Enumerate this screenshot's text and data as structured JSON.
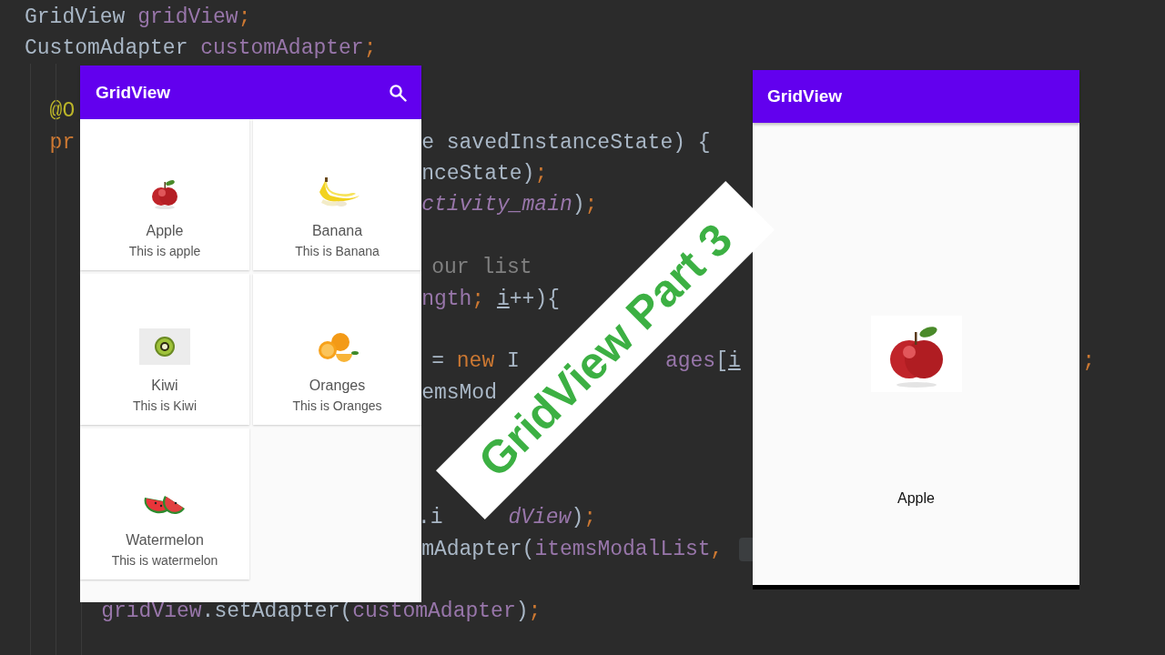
{
  "editor": {
    "lines": [
      {
        "fragments": [
          {
            "parts": [
              {
                "text": "GridView ",
                "kind": "plain"
              },
              {
                "text": "gridView",
                "kind": "field"
              },
              {
                "text": ";",
                "kind": "punct"
              }
            ]
          }
        ]
      },
      {
        "fragments": [
          {
            "parts": [
              {
                "text": "CustomAdapter ",
                "kind": "plain"
              },
              {
                "text": "customAdapter",
                "kind": "field"
              },
              {
                "text": ";",
                "kind": "punct"
              }
            ]
          }
        ]
      },
      {
        "fragments": [
          {
            "parts": [
              {
                "text": "@O",
                "kind": "annotation"
              }
            ]
          }
        ]
      },
      {
        "fragments": [
          {
            "parts": [
              {
                "text": "pr",
                "kind": "keyword"
              }
            ]
          },
          {
            "parts": [
              {
                "text": "e savedInstanceState) {",
                "kind": "plain"
              }
            ]
          }
        ]
      },
      {
        "fragments": [
          {
            "parts": [
              {
                "text": "nceState)",
                "kind": "plain"
              },
              {
                "text": ";",
                "kind": "punct"
              }
            ]
          }
        ]
      },
      {
        "fragments": [
          {
            "parts": [
              {
                "text": "ctivity_main",
                "kind": "italic"
              },
              {
                "text": ")",
                "kind": "plain"
              },
              {
                "text": ";",
                "kind": "punct"
              }
            ]
          }
        ]
      },
      {
        "fragments": [
          {
            "parts": [
              {
                "text": "our list",
                "kind": "comment"
              }
            ]
          }
        ]
      },
      {
        "fragments": [
          {
            "parts": [
              {
                "text": "ngth",
                "kind": "field"
              },
              {
                "text": "; ",
                "kind": "punct"
              },
              {
                "text": "i",
                "kind": "underline"
              },
              {
                "text": "++){",
                "kind": "plain"
              }
            ]
          }
        ]
      },
      {
        "fragments": [
          {
            "parts": [
              {
                "text": "= ",
                "kind": "plain"
              },
              {
                "text": "new ",
                "kind": "keyword"
              },
              {
                "text": "I",
                "kind": "plain"
              }
            ]
          },
          {
            "parts": [
              {
                "text": "ages",
                "kind": "field"
              },
              {
                "text": "[",
                "kind": "plain"
              },
              {
                "text": "i",
                "kind": "underline"
              }
            ]
          },
          {
            "parts": [
              {
                "text": ";",
                "kind": "punct"
              }
            ]
          }
        ]
      },
      {
        "fragments": [
          {
            "parts": [
              {
                "text": "emsMod",
                "kind": "plain"
              }
            ]
          }
        ]
      },
      {
        "fragments": [
          {
            "parts": [
              {
                "text": ".i",
                "kind": "plain"
              }
            ]
          },
          {
            "parts": [
              {
                "text": "dView",
                "kind": "italic"
              },
              {
                "text": ")",
                "kind": "plain"
              },
              {
                "text": ";",
                "kind": "punct"
              }
            ]
          }
        ]
      },
      {
        "fragments": [
          {
            "parts": [
              {
                "text": "mAdapter(",
                "kind": "plain"
              },
              {
                "text": "itemsModalList",
                "kind": "field"
              },
              {
                "text": ", ",
                "kind": "punct"
              }
            ]
          }
        ]
      },
      {
        "fragments": [
          {
            "parts": [
              {
                "text": "gridView",
                "kind": "field"
              },
              {
                "text": ".setAdapter(",
                "kind": "plain"
              },
              {
                "text": "customAdapter",
                "kind": "field"
              },
              {
                "text": ")",
                "kind": "plain"
              },
              {
                "text": ";",
                "kind": "punct"
              }
            ]
          }
        ]
      }
    ]
  },
  "grid_app": {
    "title": "GridView",
    "items": [
      {
        "name": "Apple",
        "description": "This is apple"
      },
      {
        "name": "Banana",
        "description": "This is Banana"
      },
      {
        "name": "Kiwi",
        "description": "This is Kiwi"
      },
      {
        "name": "Oranges",
        "description": "This is Oranges"
      },
      {
        "name": "Watermelon",
        "description": "This is watermelon"
      }
    ]
  },
  "detail_app": {
    "title": "GridView",
    "name": "Apple"
  },
  "banner": {
    "text": "GridView Part 3"
  }
}
